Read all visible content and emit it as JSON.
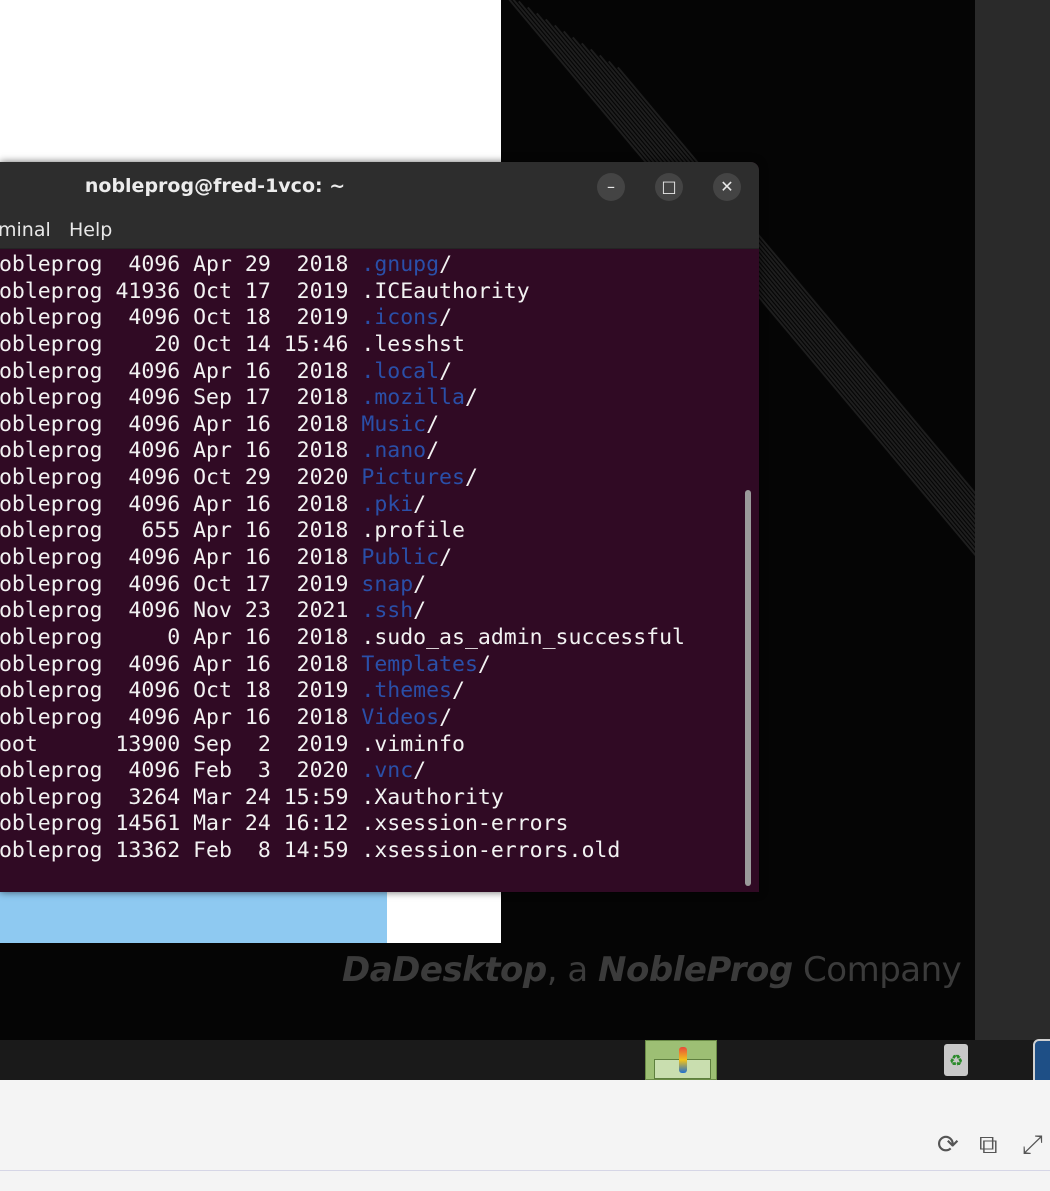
{
  "window": {
    "title": "nobleprog@fred-1vco: ~",
    "minimize_icon": "–",
    "maximize_icon": "□",
    "close_icon": "✕"
  },
  "menubar": [
    "minal",
    "Help"
  ],
  "listing": [
    {
      "owner": "nobleprog",
      "size": "4096",
      "month": "Apr",
      "day": "29",
      "time": "2018",
      "name": ".gnupg",
      "dir": true
    },
    {
      "owner": "nobleprog",
      "size": "41936",
      "month": "Oct",
      "day": "17",
      "time": "2019",
      "name": ".ICEauthority",
      "dir": false
    },
    {
      "owner": "nobleprog",
      "size": "4096",
      "month": "Oct",
      "day": "18",
      "time": "2019",
      "name": ".icons",
      "dir": true
    },
    {
      "owner": "nobleprog",
      "size": "20",
      "month": "Oct",
      "day": "14",
      "time": "15:46",
      "name": ".lesshst",
      "dir": false
    },
    {
      "owner": "nobleprog",
      "size": "4096",
      "month": "Apr",
      "day": "16",
      "time": "2018",
      "name": ".local",
      "dir": true
    },
    {
      "owner": "nobleprog",
      "size": "4096",
      "month": "Sep",
      "day": "17",
      "time": "2018",
      "name": ".mozilla",
      "dir": true
    },
    {
      "owner": "nobleprog",
      "size": "4096",
      "month": "Apr",
      "day": "16",
      "time": "2018",
      "name": "Music",
      "dir": true
    },
    {
      "owner": "nobleprog",
      "size": "4096",
      "month": "Apr",
      "day": "16",
      "time": "2018",
      "name": ".nano",
      "dir": true
    },
    {
      "owner": "nobleprog",
      "size": "4096",
      "month": "Oct",
      "day": "29",
      "time": "2020",
      "name": "Pictures",
      "dir": true
    },
    {
      "owner": "nobleprog",
      "size": "4096",
      "month": "Apr",
      "day": "16",
      "time": "2018",
      "name": ".pki",
      "dir": true
    },
    {
      "owner": "nobleprog",
      "size": "655",
      "month": "Apr",
      "day": "16",
      "time": "2018",
      "name": ".profile",
      "dir": false
    },
    {
      "owner": "nobleprog",
      "size": "4096",
      "month": "Apr",
      "day": "16",
      "time": "2018",
      "name": "Public",
      "dir": true
    },
    {
      "owner": "nobleprog",
      "size": "4096",
      "month": "Oct",
      "day": "17",
      "time": "2019",
      "name": "snap",
      "dir": true
    },
    {
      "owner": "nobleprog",
      "size": "4096",
      "month": "Nov",
      "day": "23",
      "time": "2021",
      "name": ".ssh",
      "dir": true
    },
    {
      "owner": "nobleprog",
      "size": "0",
      "month": "Apr",
      "day": "16",
      "time": "2018",
      "name": ".sudo_as_admin_successful",
      "dir": false
    },
    {
      "owner": "nobleprog",
      "size": "4096",
      "month": "Apr",
      "day": "16",
      "time": "2018",
      "name": "Templates",
      "dir": true
    },
    {
      "owner": "nobleprog",
      "size": "4096",
      "month": "Oct",
      "day": "18",
      "time": "2019",
      "name": ".themes",
      "dir": true
    },
    {
      "owner": "nobleprog",
      "size": "4096",
      "month": "Apr",
      "day": "16",
      "time": "2018",
      "name": "Videos",
      "dir": true
    },
    {
      "owner": "root",
      "size": "13900",
      "month": "Sep",
      "day": "2",
      "time": "2019",
      "name": ".viminfo",
      "dir": false
    },
    {
      "owner": "nobleprog",
      "size": "4096",
      "month": "Feb",
      "day": "3",
      "time": "2020",
      "name": ".vnc",
      "dir": true
    },
    {
      "owner": "nobleprog",
      "size": "3264",
      "month": "Mar",
      "day": "24",
      "time": "15:59",
      "name": ".Xauthority",
      "dir": false
    },
    {
      "owner": "nobleprog",
      "size": "14561",
      "month": "Mar",
      "day": "24",
      "time": "16:12",
      "name": ".xsession-errors",
      "dir": false
    },
    {
      "owner": "nobleprog",
      "size": "13362",
      "month": "Feb",
      "day": "8",
      "time": "14:59",
      "name": ".xsession-errors.old",
      "dir": false
    }
  ],
  "brand": {
    "part1": "DaDesktop",
    "part2": ", a ",
    "part3": "NobleProg",
    "part4": " Company"
  },
  "colors": {
    "terminal_bg": "#300a24",
    "dir_color": "#2a4fa8",
    "titlebar": "#2d2d2d"
  },
  "controls": {
    "refresh_icon": "⟳",
    "external_icon": "⧉",
    "fullscreen_icon": "⤢"
  }
}
